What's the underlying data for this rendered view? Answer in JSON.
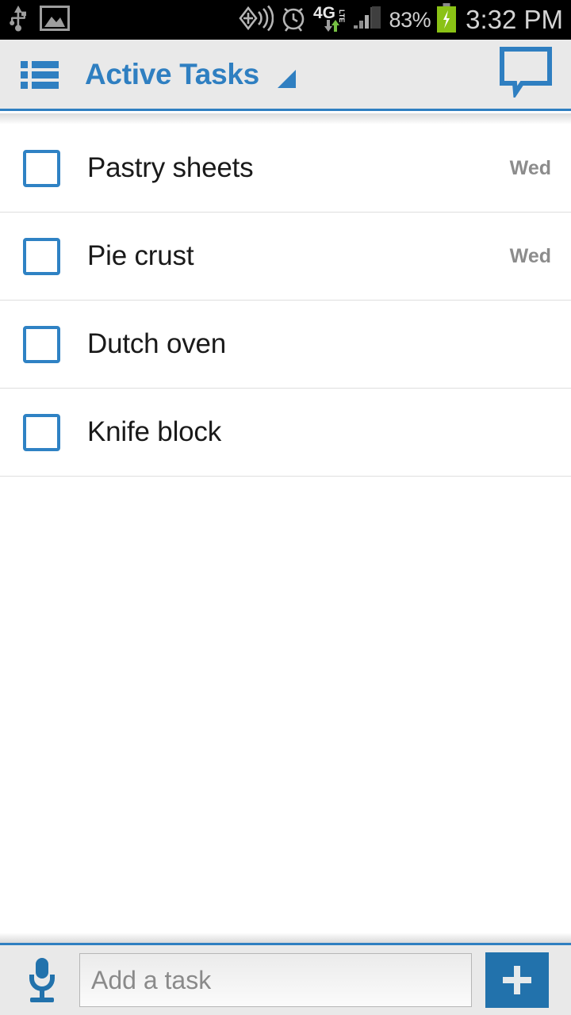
{
  "statusbar": {
    "left_icons": [
      "usb-icon",
      "screenshot-image-icon"
    ],
    "right_icons": [
      "gps-location-icon",
      "alarm-clock-icon",
      "network-4g-lte-icon",
      "signal-bars-icon",
      "battery-charging-icon"
    ],
    "battery_percent": "83%",
    "network_label": "4G",
    "network_sub_label": "LTE",
    "clock": "3:32 PM",
    "background": "#000000",
    "foreground": "#cfcfcf",
    "battery_color": "#8ac215"
  },
  "actionbar": {
    "menu_icon": "list-menu-icon",
    "title": "Active Tasks",
    "caret_icon": "dropdown-triangle-icon",
    "chat_icon": "speech-bubble-icon",
    "accent": "#2f7fc1",
    "background": "#e9e9e9"
  },
  "tasks": [
    {
      "title": "Pastry sheets",
      "due": "Wed",
      "checked": false
    },
    {
      "title": "Pie crust",
      "due": "Wed",
      "checked": false
    },
    {
      "title": "Dutch oven",
      "due": "",
      "checked": false
    },
    {
      "title": "Knife block",
      "due": "",
      "checked": false
    }
  ],
  "bottombar": {
    "mic_icon": "microphone-icon",
    "input_value": "",
    "input_placeholder": "Add a task",
    "add_icon": "plus-icon",
    "add_label": "+",
    "accent": "#2272ac"
  }
}
